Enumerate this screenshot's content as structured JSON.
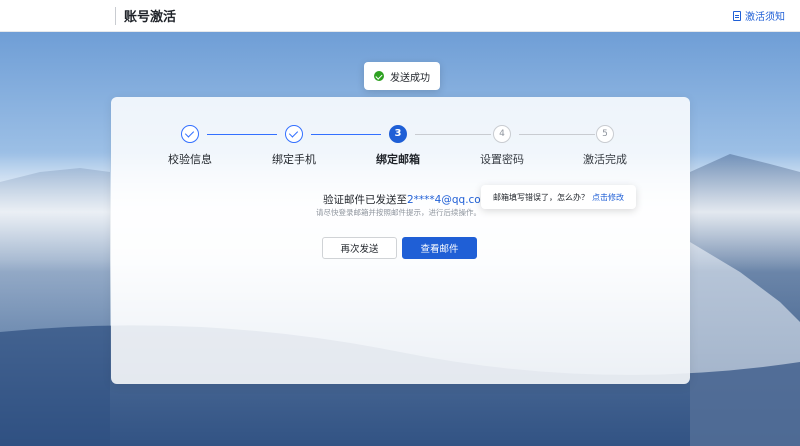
{
  "header": {
    "title": "账号激活",
    "notice_label": "激活须知"
  },
  "toast": {
    "text": "发送成功"
  },
  "steps": [
    {
      "label": "校验信息",
      "state": "done",
      "number": ""
    },
    {
      "label": "绑定手机",
      "state": "done",
      "number": ""
    },
    {
      "label": "绑定邮箱",
      "state": "active",
      "number": "3"
    },
    {
      "label": "设置密码",
      "state": "todo",
      "number": "4"
    },
    {
      "label": "激活完成",
      "state": "todo",
      "number": "5"
    }
  ],
  "message": {
    "prefix": "验证邮件已发送至",
    "email": "2****4@qq.com",
    "hint": "请尽快登录邮箱并按照邮件提示，进行后续操作。"
  },
  "tooltip": {
    "text": "邮箱填写错误了，怎么办？",
    "link": "点击修改"
  },
  "buttons": {
    "resend": "再次发送",
    "view_mail": "查看邮件"
  },
  "colors": {
    "primary": "#1f5fd6",
    "success": "#2ea121"
  }
}
